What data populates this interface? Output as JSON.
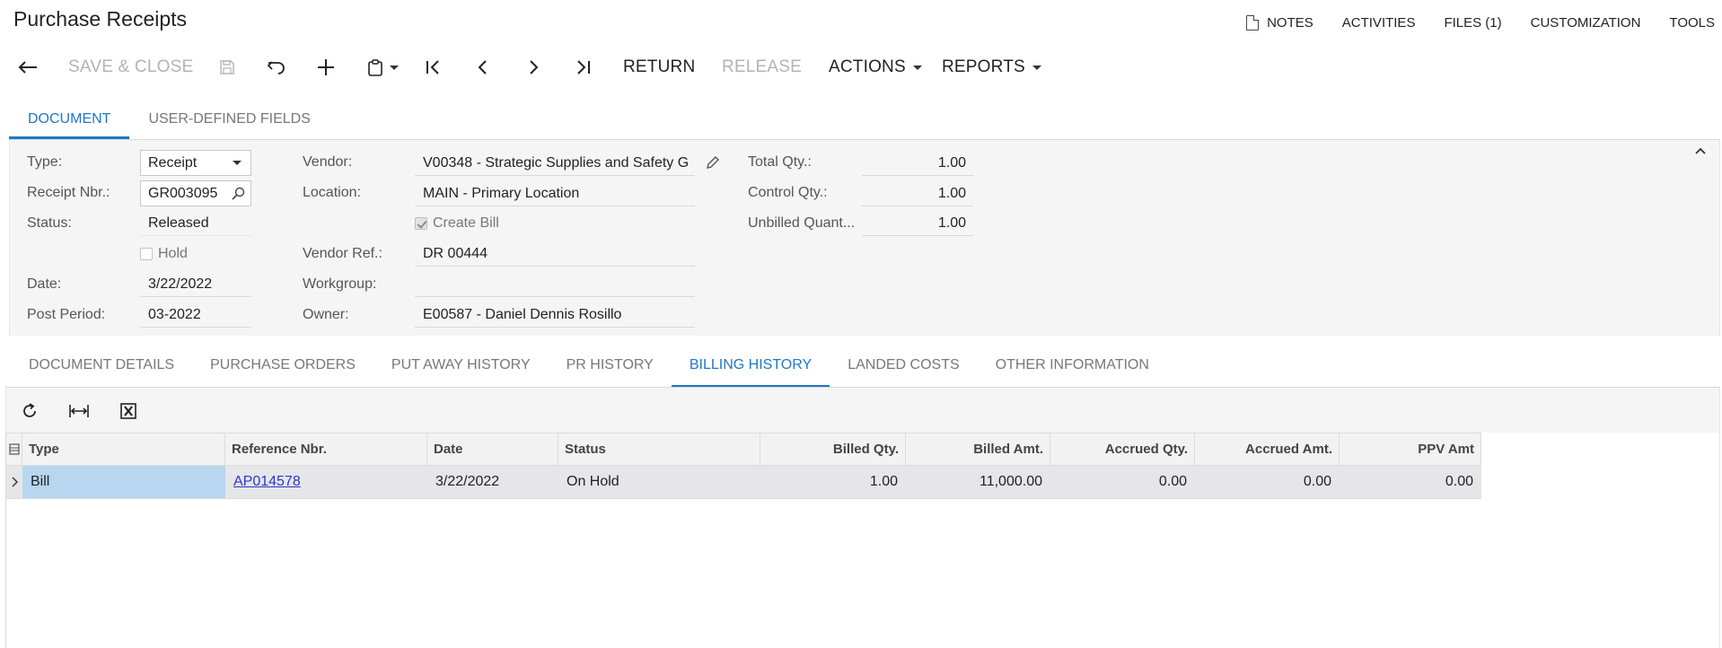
{
  "header": {
    "title": "Purchase Receipts",
    "links": {
      "notes": "NOTES",
      "activities": "ACTIVITIES",
      "files": "FILES (1)",
      "customization": "CUSTOMIZATION",
      "tools": "TOOLS"
    }
  },
  "toolbar": {
    "save_close": "SAVE & CLOSE",
    "return": "RETURN",
    "release": "RELEASE",
    "actions": "ACTIONS",
    "reports": "REPORTS"
  },
  "main_tabs": [
    "DOCUMENT",
    "USER-DEFINED FIELDS"
  ],
  "form": {
    "type": {
      "label": "Type:",
      "value": "Receipt"
    },
    "receipt_nbr": {
      "label": "Receipt Nbr.:",
      "value": "GR003095"
    },
    "status": {
      "label": "Status:",
      "value": "Released"
    },
    "hold": {
      "label": "Hold",
      "checked": false
    },
    "date": {
      "label": "Date:",
      "value": "3/22/2022"
    },
    "post_period": {
      "label": "Post Period:",
      "value": "03-2022"
    },
    "vendor": {
      "label": "Vendor:",
      "value": "V00348 - Strategic Supplies and Safety G"
    },
    "location": {
      "label": "Location:",
      "value": "MAIN - Primary Location"
    },
    "create_bill": {
      "label": "Create Bill",
      "checked": true
    },
    "vendor_ref": {
      "label": "Vendor Ref.:",
      "value": "DR 00444"
    },
    "workgroup": {
      "label": "Workgroup:",
      "value": ""
    },
    "owner": {
      "label": "Owner:",
      "value": "E00587 - Daniel Dennis Rosillo"
    },
    "total_qty": {
      "label": "Total Qty.:",
      "value": "1.00"
    },
    "control_qty": {
      "label": "Control Qty.:",
      "value": "1.00"
    },
    "unbilled_qty": {
      "label": "Unbilled Quant...",
      "value": "1.00"
    }
  },
  "detail_tabs": [
    "DOCUMENT DETAILS",
    "PURCHASE ORDERS",
    "PUT AWAY HISTORY",
    "PR HISTORY",
    "BILLING HISTORY",
    "LANDED COSTS",
    "OTHER INFORMATION"
  ],
  "grid": {
    "columns": [
      "Type",
      "Reference Nbr.",
      "Date",
      "Status",
      "Billed Qty.",
      "Billed Amt.",
      "Accrued Qty.",
      "Accrued Amt.",
      "PPV Amt"
    ],
    "rows": [
      [
        "Bill",
        "AP014578",
        "3/22/2022",
        "On Hold",
        "1.00",
        "11,000.00",
        "0.00",
        "0.00",
        "0.00"
      ]
    ]
  },
  "colors": {
    "accent": "#1f77c8",
    "selected_cell": "#b8d6ef",
    "link": "#2a37c8",
    "panel_bg": "#f5f5f5"
  }
}
